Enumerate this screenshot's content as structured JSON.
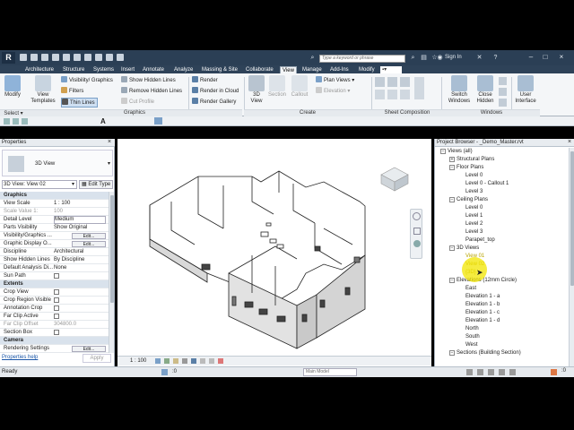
{
  "titlebar": {
    "search_placeholder": "Type a keyword or phrase",
    "sign_in": "Sign In"
  },
  "tabs": [
    "Architecture",
    "Structure",
    "Systems",
    "Insert",
    "Annotate",
    "Analyze",
    "Massing & Site",
    "Collaborate",
    "View",
    "Manage",
    "Add-Ins",
    "Modify"
  ],
  "active_tab": "View",
  "ribbon": {
    "modify": "Modify",
    "view_templates": "View Templates",
    "visibility_graphics": "Visibility/ Graphics",
    "filters": "Filters",
    "thin_lines": "Thin Lines",
    "show_hidden_lines": "Show Hidden Lines",
    "remove_hidden_lines": "Remove Hidden Lines",
    "cut_profile": "Cut Profile",
    "render": "Render",
    "render_in_cloud": "Render in Cloud",
    "render_gallery": "Render Gallery",
    "view_3d": "3D View",
    "section": "Section",
    "callout": "Callout",
    "plan_views": "Plan Views",
    "elevation": "Elevation",
    "switch_windows": "Switch Windows",
    "close_hidden": "Close Hidden",
    "user_interface": "User Interface",
    "group_select": "Select",
    "group_graphics": "Graphics",
    "group_create": "Create",
    "group_sheet": "Sheet Composition",
    "group_windows": "Windows"
  },
  "properties": {
    "title": "Properties",
    "type_name": "3D View",
    "selector": "3D View: View 02",
    "edit_type": "Edit Type",
    "help_link": "Properties help",
    "apply": "Apply",
    "rows": [
      {
        "k": "Graphics",
        "v": "",
        "section": true
      },
      {
        "k": "View Scale",
        "v": "1 : 100"
      },
      {
        "k": "Scale Value    1:",
        "v": "100",
        "dim": true
      },
      {
        "k": "Detail Level",
        "v": "Medium"
      },
      {
        "k": "Parts Visibility",
        "v": "Show Original"
      },
      {
        "k": "Visibility/Graphics ...",
        "v": "Edit...",
        "btn": true
      },
      {
        "k": "Graphic Display O...",
        "v": "Edit...",
        "btn": true
      },
      {
        "k": "Discipline",
        "v": "Architectural"
      },
      {
        "k": "Show Hidden Lines",
        "v": "By Discipline"
      },
      {
        "k": "Default Analysis Di...",
        "v": "None"
      },
      {
        "k": "Sun Path",
        "v": "",
        "cb": true
      },
      {
        "k": "Extents",
        "v": "",
        "section": true
      },
      {
        "k": "Crop View",
        "v": "",
        "cb": true
      },
      {
        "k": "Crop Region Visible",
        "v": "",
        "cb": true
      },
      {
        "k": "Annotation Crop",
        "v": "",
        "cb": true
      },
      {
        "k": "Far Clip Active",
        "v": "",
        "cb": true
      },
      {
        "k": "Far Clip Offset",
        "v": "304800.0",
        "dim": true
      },
      {
        "k": "Section Box",
        "v": "",
        "cb": true
      },
      {
        "k": "Camera",
        "v": "",
        "section": true
      },
      {
        "k": "Rendering Settings",
        "v": "Edit...",
        "btn": true
      }
    ]
  },
  "project_browser": {
    "title": "Project Browser - _Demo_Master.rvt",
    "items": [
      {
        "t": "Views (all)",
        "lvl": 0,
        "exp": "-"
      },
      {
        "t": "Structural Plans",
        "lvl": 1,
        "exp": "+"
      },
      {
        "t": "Floor Plans",
        "lvl": 1,
        "exp": "-"
      },
      {
        "t": "Level 0",
        "lvl": 2
      },
      {
        "t": "Level 0 - Callout 1",
        "lvl": 2
      },
      {
        "t": "Level 3",
        "lvl": 2
      },
      {
        "t": "Ceiling Plans",
        "lvl": 1,
        "exp": "-"
      },
      {
        "t": "Level 0",
        "lvl": 2
      },
      {
        "t": "Level 1",
        "lvl": 2
      },
      {
        "t": "Level 2",
        "lvl": 2
      },
      {
        "t": "Level 3",
        "lvl": 2
      },
      {
        "t": "Parapet_top",
        "lvl": 2
      },
      {
        "t": "3D Views",
        "lvl": 1,
        "exp": "-"
      },
      {
        "t": "View 01",
        "lvl": 2,
        "hl": true
      },
      {
        "t": "View 02",
        "lvl": 2,
        "hl": true
      },
      {
        "t": "{3D}",
        "lvl": 2,
        "hl": true
      },
      {
        "t": "Elevations (12mm Circle)",
        "lvl": 1,
        "exp": "-"
      },
      {
        "t": "East",
        "lvl": 2
      },
      {
        "t": "Elevation 1 - a",
        "lvl": 2
      },
      {
        "t": "Elevation 1 - b",
        "lvl": 2
      },
      {
        "t": "Elevation 1 - c",
        "lvl": 2
      },
      {
        "t": "Elevation 1 - d",
        "lvl": 2
      },
      {
        "t": "North",
        "lvl": 2
      },
      {
        "t": "South",
        "lvl": 2
      },
      {
        "t": "West",
        "lvl": 2
      },
      {
        "t": "Sections (Building Section)",
        "lvl": 1,
        "exp": "-"
      }
    ]
  },
  "viewcube": {
    "face": "FRONT"
  },
  "view_bar": {
    "scale": "1 : 100"
  },
  "status": {
    "left": "Ready",
    "model": "Main Model",
    "count": ":0"
  },
  "colors": {
    "title_bg": "#2b3f55",
    "ribbon_bg": "#f4f6f8",
    "highlight": "#f2e600"
  }
}
